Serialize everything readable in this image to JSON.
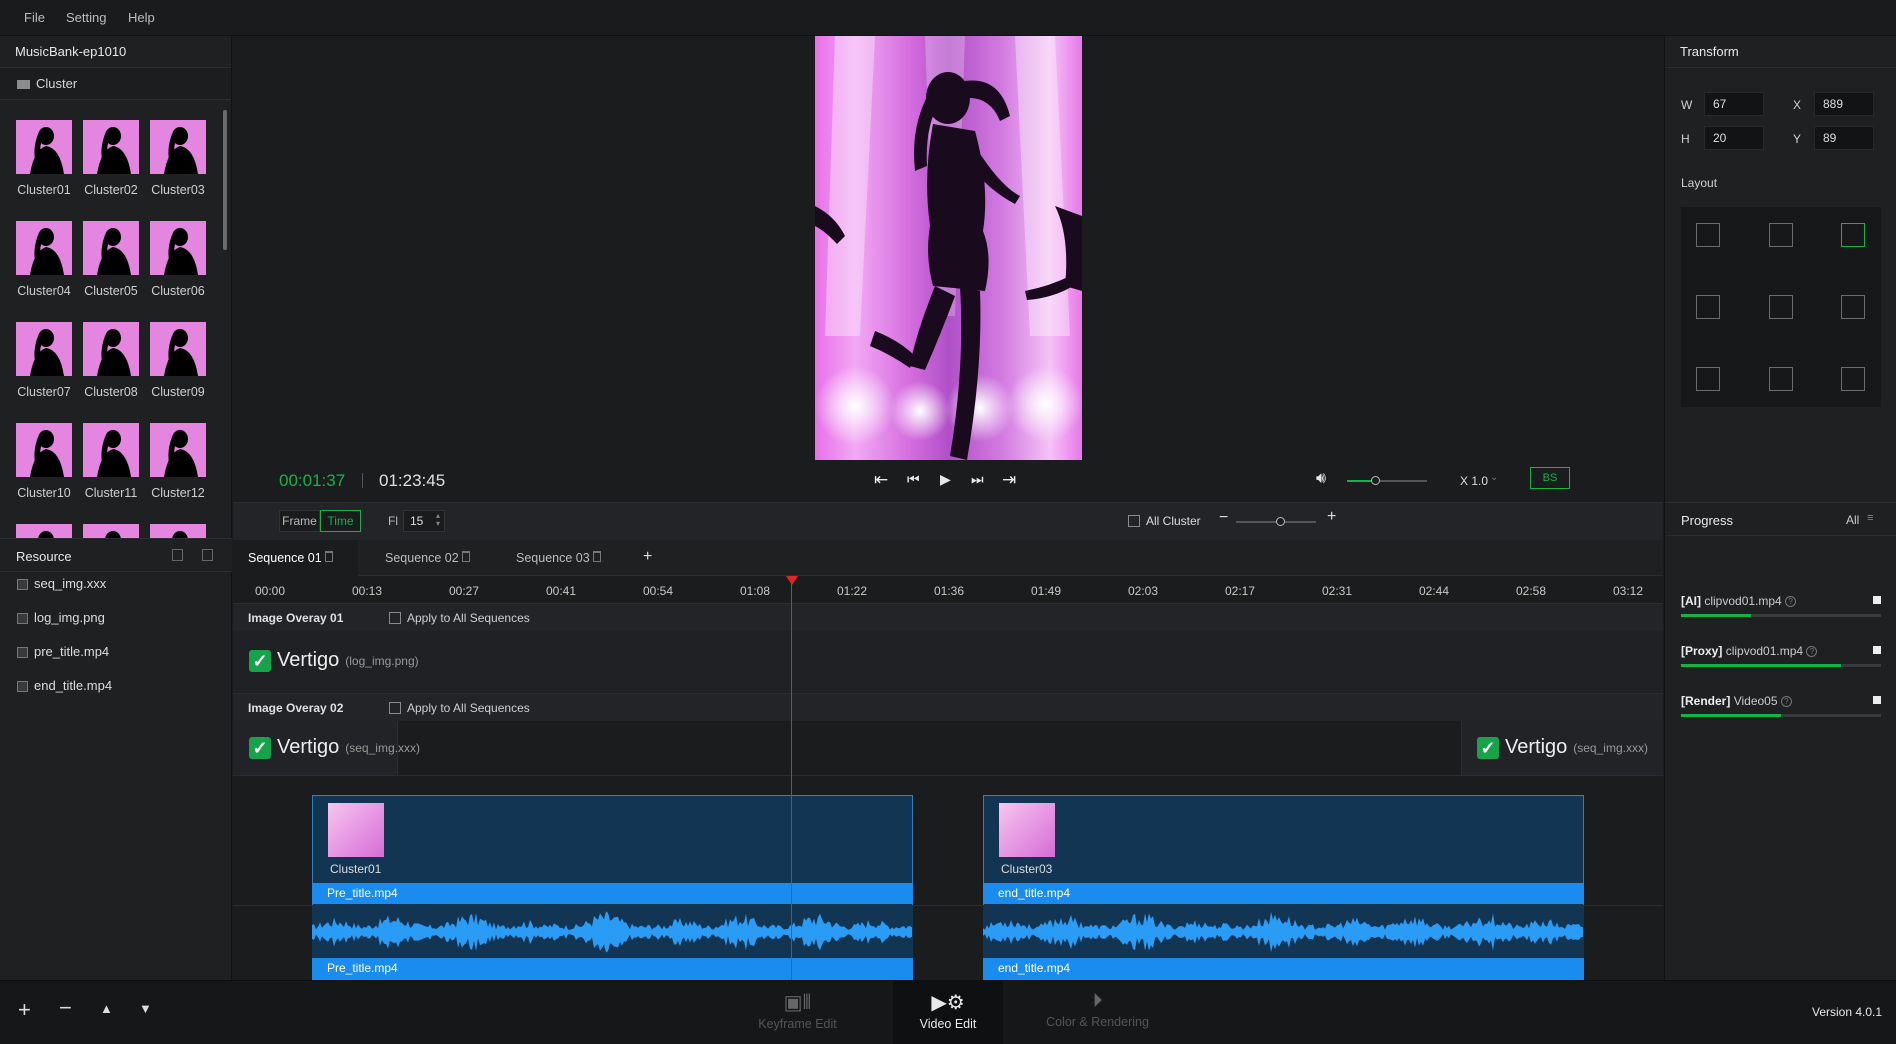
{
  "menu": {
    "file": "File",
    "setting": "Setting",
    "help": "Help"
  },
  "project": {
    "title": "MusicBank-ep1010",
    "folder": "Cluster"
  },
  "clusters": [
    "Cluster01",
    "Cluster02",
    "Cluster03",
    "Cluster04",
    "Cluster05",
    "Cluster06",
    "Cluster07",
    "Cluster08",
    "Cluster09",
    "Cluster10",
    "Cluster11",
    "Cluster12"
  ],
  "resource": {
    "title": "Resource",
    "items": [
      "seq_img.xxx",
      "log_img.png",
      "pre_title.mp4",
      "end_title.mp4"
    ]
  },
  "transport": {
    "current_time": "00:01:37",
    "total_time": "01:23:45",
    "speed": "X 1.0",
    "bs": "BS",
    "volume": 0.35
  },
  "framebar": {
    "frame": "Frame",
    "time": "Time",
    "fl_label": "Fl",
    "fl_value": "15",
    "all_cluster": "All Cluster",
    "zoom": 0.55
  },
  "transform": {
    "title": "Transform",
    "w_label": "W",
    "w": "67",
    "h_label": "H",
    "h": "20",
    "x_label": "X",
    "x": "889",
    "y_label": "Y",
    "y": "89",
    "layout": "Layout",
    "selected_layout": 2
  },
  "sequences": {
    "tabs": [
      "Sequence 01",
      "Sequence 02",
      "Sequence 03"
    ],
    "add": "+"
  },
  "ruler": [
    "00:00",
    "00:13",
    "00:27",
    "00:41",
    "00:54",
    "01:08",
    "01:22",
    "01:36",
    "01:49",
    "02:03",
    "02:17",
    "02:31",
    "02:44",
    "02:58",
    "03:12"
  ],
  "tracks": {
    "overlay1": {
      "title": "Image Overay 01",
      "apply": "Apply to All Sequences",
      "logo": "Vertigo",
      "file": "(log_img.png)"
    },
    "overlay2": {
      "title": "Image Overay 02",
      "apply": "Apply to All Sequences",
      "logo": "Vertigo",
      "file": "(seq_img.xxx)",
      "logo2": "Vertigo",
      "file2": "(seq_img.xxx)"
    },
    "clip1": {
      "label": "Cluster01",
      "video": "Pre_title.mp4",
      "audio": "Pre_title.mp4"
    },
    "clip2": {
      "label": "Cluster03",
      "video": "end_title.mp4",
      "audio": "end_title.mp4"
    }
  },
  "progress": {
    "title": "Progress",
    "filter": "All",
    "items": [
      {
        "tag": "[AI]",
        "file": "clipvod01.mp4",
        "value": 0.35
      },
      {
        "tag": "[Proxy]",
        "file": "clipvod01.mp4",
        "value": 0.8
      },
      {
        "tag": "[Render]",
        "file": "Video05",
        "value": 0.5
      }
    ]
  },
  "bottom": {
    "keyframe": "Keyframe Edit",
    "video": "Video Edit",
    "color": "Color & Rendering",
    "version": "Version 4.0.1"
  },
  "colors": {
    "accent_green": "#13b34a",
    "clip_blue": "#1a8cf0",
    "playhead": "#e0242a"
  }
}
